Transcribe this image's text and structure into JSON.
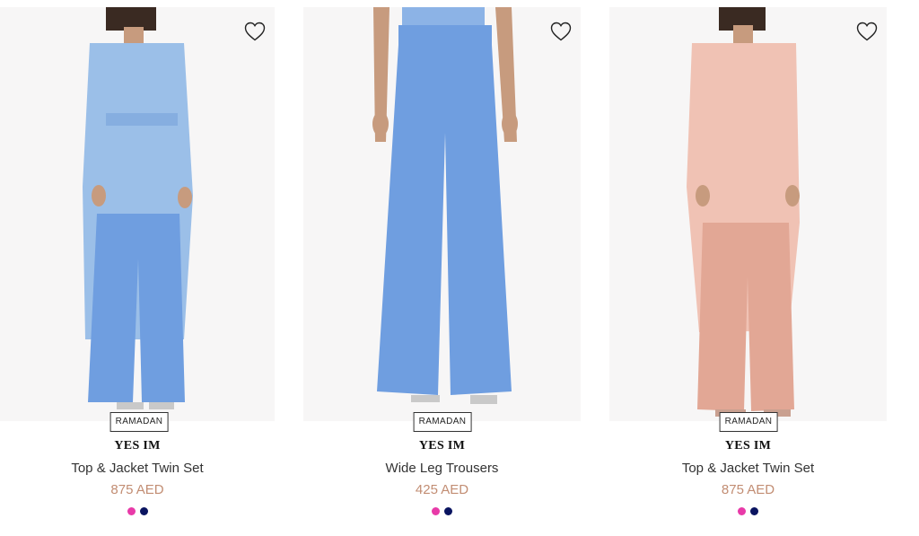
{
  "products": [
    {
      "tag": "RAMADAN",
      "brand": "YES IM",
      "name": "Top & Jacket Twin Set",
      "price": "875 AED",
      "top_color": "#9bbfe8",
      "bottom_color": "#6f9ee0",
      "swatches": [
        "#e83aa8",
        "#0a1460"
      ]
    },
    {
      "tag": "RAMADAN",
      "brand": "YES IM",
      "name": "Wide Leg Trousers",
      "price": "425 AED",
      "top_color": "#6f9ee0",
      "bottom_color": "#6f9ee0",
      "swatches": [
        "#e83aa8",
        "#0a1460"
      ]
    },
    {
      "tag": "RAMADAN",
      "brand": "YES IM",
      "name": "Top & Jacket Twin Set",
      "price": "875 AED",
      "top_color": "#f0c2b4",
      "bottom_color": "#e2a795",
      "swatches": [
        "#e83aa8",
        "#0a1460"
      ]
    }
  ]
}
